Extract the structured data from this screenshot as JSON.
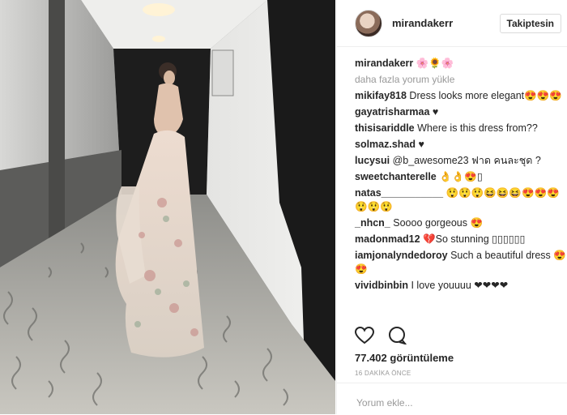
{
  "post": {
    "username": "mirandakerr",
    "follow_label": "Takiptesin",
    "caption_emojis": "🌸🌻🌸",
    "load_more": "daha fazla yorum yükle",
    "views": "77.402 görüntüleme",
    "time": "16 DAKİKA ÖNCE",
    "comment_placeholder": "Yorum ekle..."
  },
  "comments": [
    {
      "user": "mikifay818",
      "text": "Dress looks more elegant😍😍😍"
    },
    {
      "user": "gayatrisharmaa",
      "text": "♥"
    },
    {
      "user": "thisisariddle",
      "text": "Where is this dress from??"
    },
    {
      "user": "solmaz.shad",
      "text": "♥"
    },
    {
      "user": "lucysui",
      "text": "@b_awesome23 ฟาด คนละชุด ?"
    },
    {
      "user": "sweetchanterelle",
      "text": "👌👌😍▯"
    },
    {
      "user": "natas___________",
      "text": "😲😲😲😆😆😆😍😍😍😲😲😲"
    },
    {
      "user": "_nhcn_",
      "text": "Soooo gorgeous 😍"
    },
    {
      "user": "madonmad12",
      "text": "💔So stunning ▯▯▯▯▯▯"
    },
    {
      "user": "iamjonalyndedoroy",
      "text": "Such a beautiful dress 😍😍"
    },
    {
      "user": "vividbinbin",
      "text": "I love youuuu ❤❤❤❤"
    }
  ],
  "icons": {
    "like": "heart-outline-icon",
    "comment": "speech-bubble-icon"
  }
}
